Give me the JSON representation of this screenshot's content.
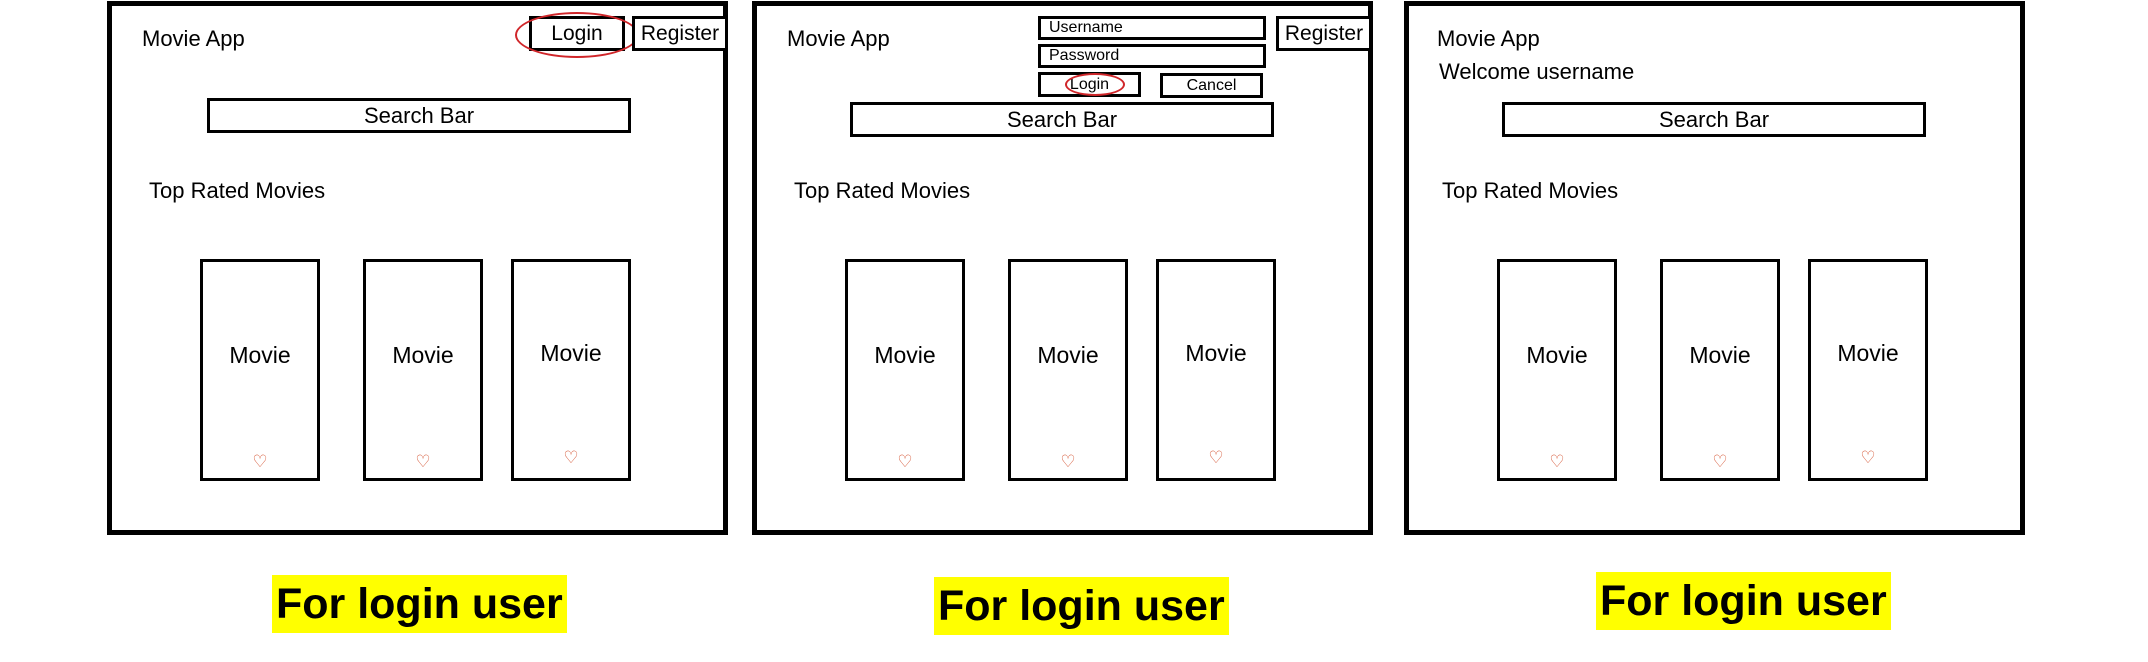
{
  "panels": [
    {
      "app_title": "Movie App",
      "login_label": "Login",
      "register_label": "Register",
      "search_label": "Search Bar",
      "section_title": "Top Rated Movies",
      "movies": [
        "Movie",
        "Movie",
        "Movie"
      ],
      "heart_glyph": "♡"
    },
    {
      "app_title": "Movie App",
      "username_label": "Username",
      "password_label": "Password",
      "login_label": "Login",
      "cancel_label": "Cancel",
      "register_label": "Register",
      "search_label": "Search Bar",
      "section_title": "Top Rated Movies",
      "movies": [
        "Movie",
        "Movie",
        "Movie"
      ],
      "heart_glyph": "♡"
    },
    {
      "app_title": "Movie App",
      "welcome_text": "Welcome username",
      "search_label": "Search Bar",
      "section_title": "Top Rated Movies",
      "movies": [
        "Movie",
        "Movie",
        "Movie"
      ],
      "heart_glyph": "♡"
    }
  ],
  "captions": [
    "For login user",
    "For login user",
    "For login user"
  ],
  "colors": {
    "highlight": "#ffff00",
    "annotation_red": "#d0262a",
    "heart": "#d65a3a",
    "border": "#000000"
  }
}
